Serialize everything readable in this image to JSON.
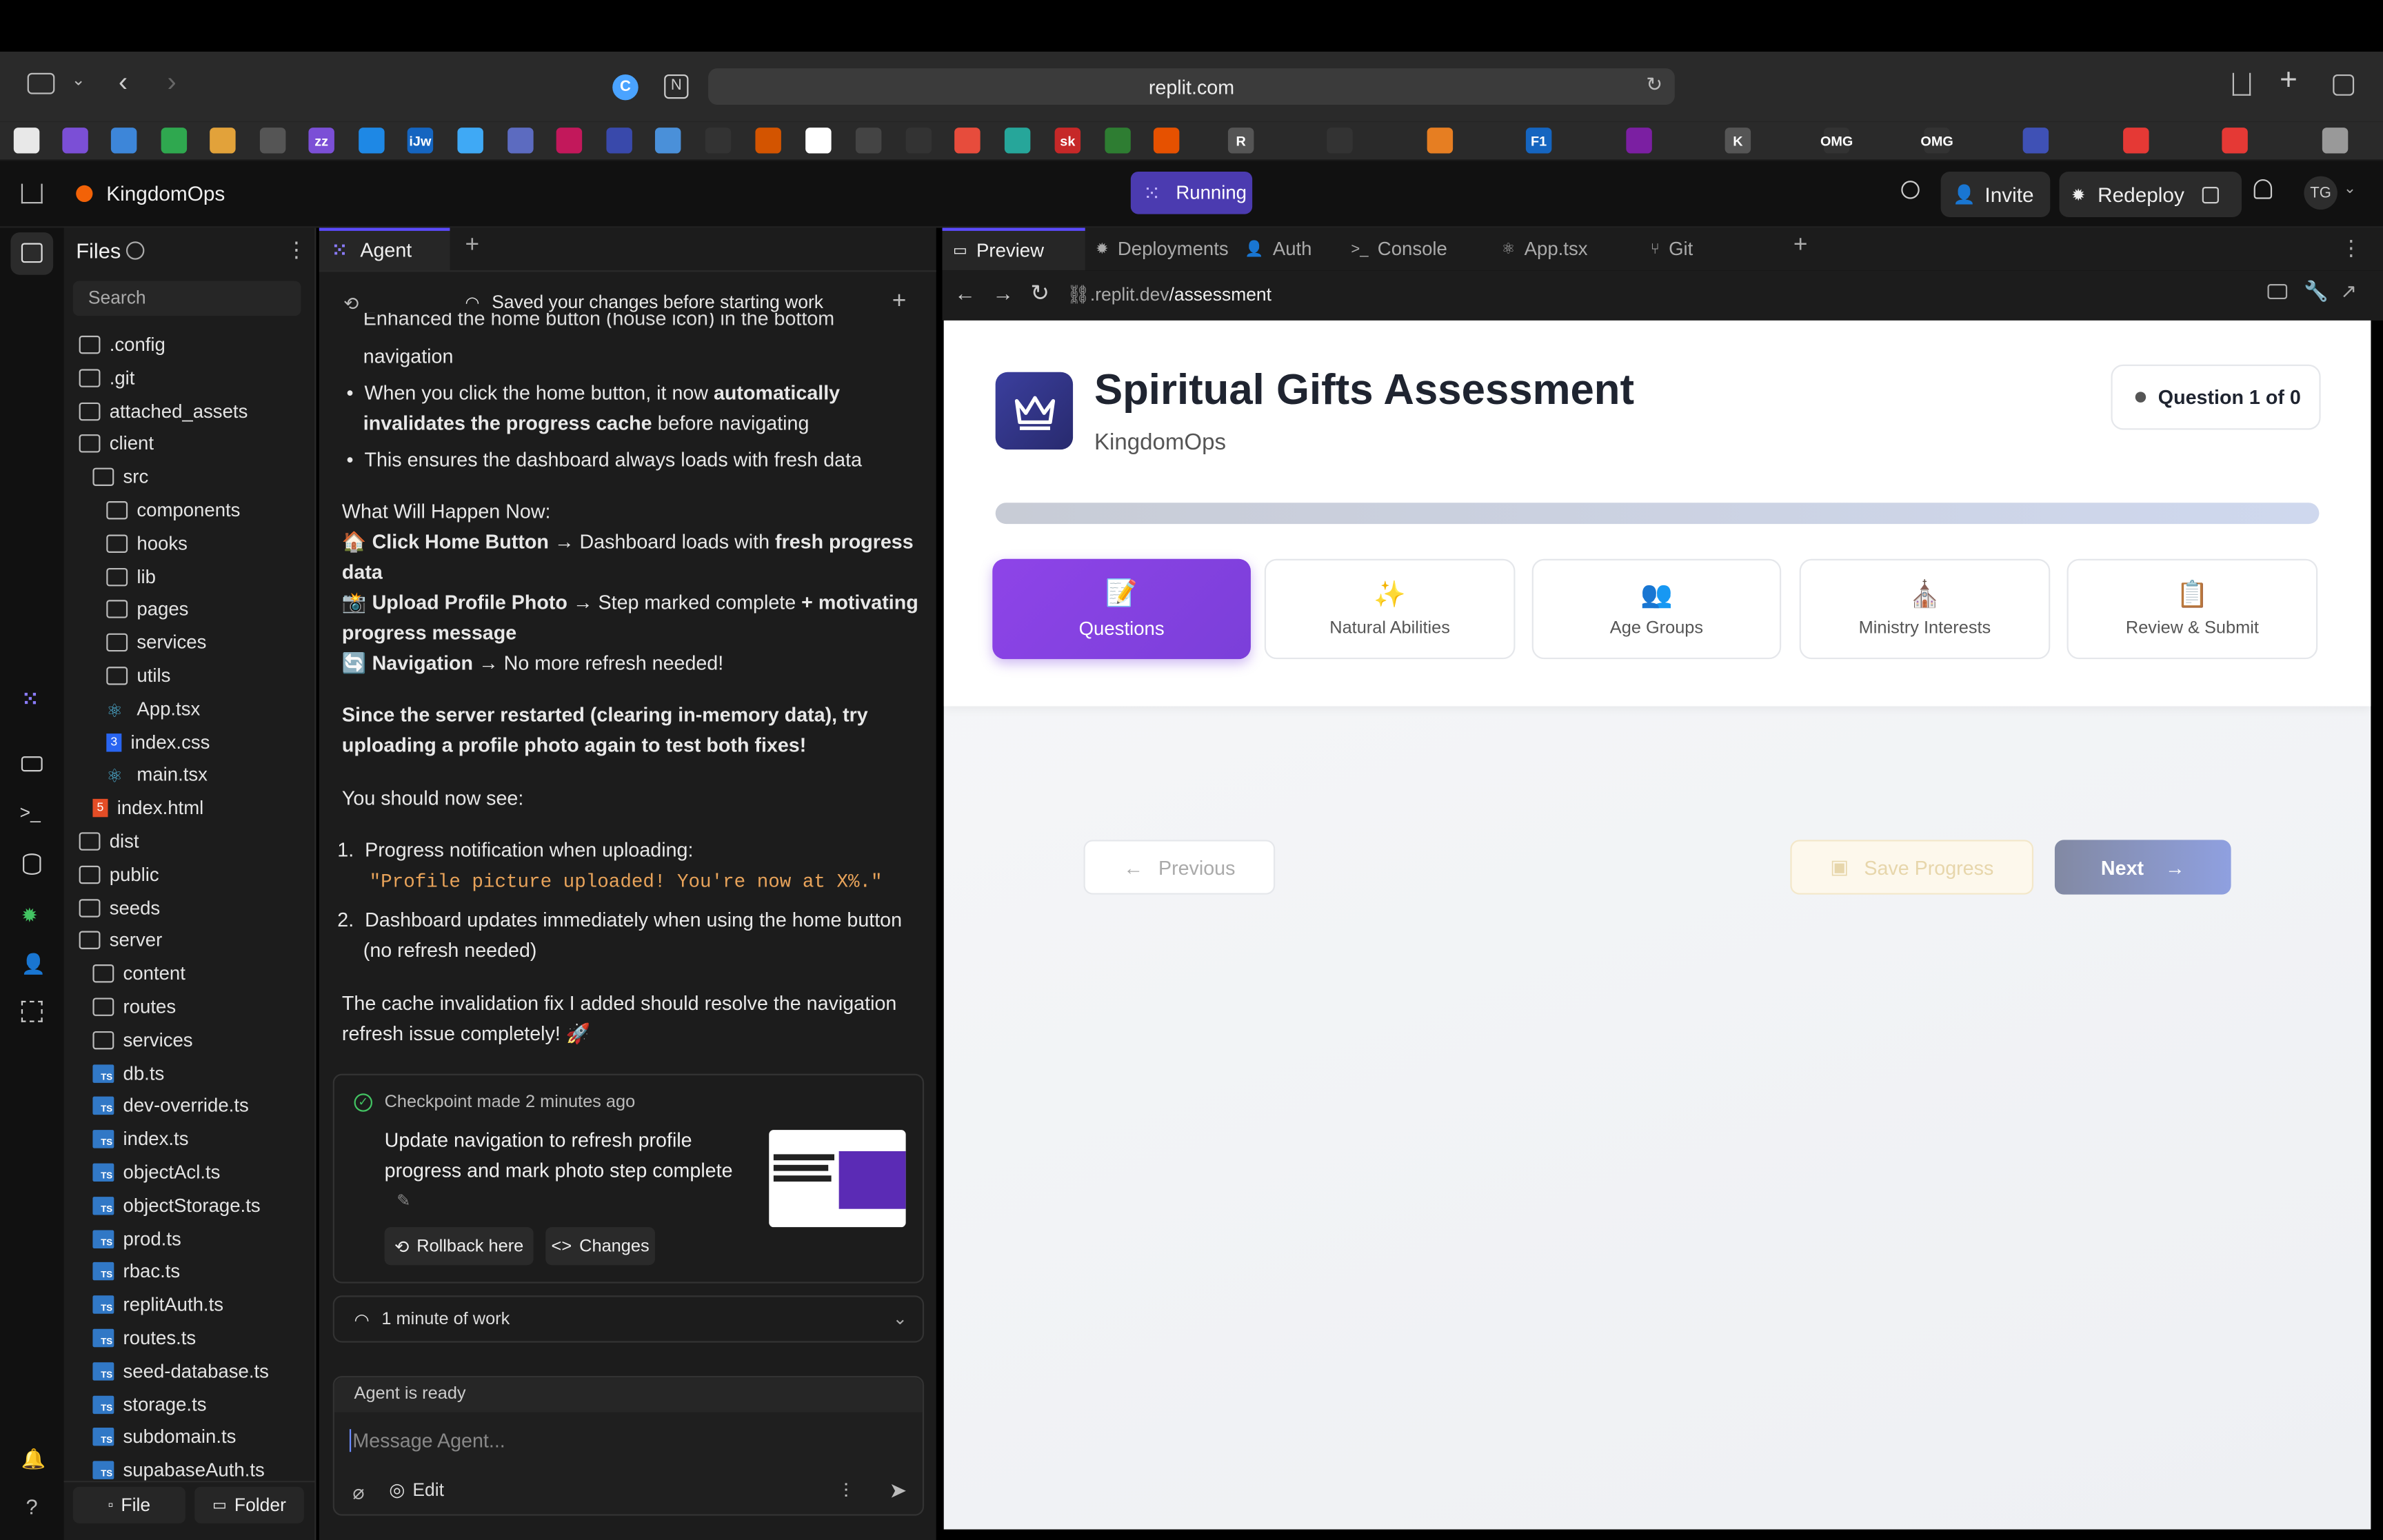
{
  "browser": {
    "url": "replit.com",
    "bookmarks": [
      "",
      "",
      "",
      "",
      "",
      "",
      "zz",
      "",
      "iJw",
      "",
      "",
      "",
      "",
      "",
      "",
      "",
      "",
      "",
      "",
      "",
      "",
      "sk",
      "",
      "",
      "R",
      "",
      "",
      "F1",
      "",
      "K",
      "OMG",
      "OMG",
      "",
      "",
      "",
      ""
    ]
  },
  "header": {
    "app_name": "KingdomOps",
    "status": "Running",
    "invite": "Invite",
    "redeploy": "Redeploy",
    "avatar": "TG"
  },
  "files": {
    "title": "Files",
    "search_placeholder": "Search",
    "items": [
      {
        "name": ".config",
        "type": "folder",
        "indent": 0
      },
      {
        "name": ".git",
        "type": "folder",
        "indent": 0
      },
      {
        "name": "attached_assets",
        "type": "folder",
        "indent": 0
      },
      {
        "name": "client",
        "type": "folder",
        "indent": 0
      },
      {
        "name": "src",
        "type": "folder",
        "indent": 1
      },
      {
        "name": "components",
        "type": "folder",
        "indent": 2
      },
      {
        "name": "hooks",
        "type": "folder",
        "indent": 2
      },
      {
        "name": "lib",
        "type": "folder",
        "indent": 2
      },
      {
        "name": "pages",
        "type": "folder",
        "indent": 2
      },
      {
        "name": "services",
        "type": "folder",
        "indent": 2
      },
      {
        "name": "utils",
        "type": "folder",
        "indent": 2
      },
      {
        "name": "App.tsx",
        "type": "react",
        "indent": 2
      },
      {
        "name": "index.css",
        "type": "css",
        "indent": 2
      },
      {
        "name": "main.tsx",
        "type": "react",
        "indent": 2
      },
      {
        "name": "index.html",
        "type": "html",
        "indent": 1
      },
      {
        "name": "dist",
        "type": "folder",
        "indent": 0
      },
      {
        "name": "public",
        "type": "folder",
        "indent": 0
      },
      {
        "name": "seeds",
        "type": "folder",
        "indent": 0
      },
      {
        "name": "server",
        "type": "folder",
        "indent": 0
      },
      {
        "name": "content",
        "type": "folder",
        "indent": 1
      },
      {
        "name": "routes",
        "type": "folder",
        "indent": 1
      },
      {
        "name": "services",
        "type": "folder",
        "indent": 1
      },
      {
        "name": "db.ts",
        "type": "ts",
        "indent": 1
      },
      {
        "name": "dev-override.ts",
        "type": "ts",
        "indent": 1
      },
      {
        "name": "index.ts",
        "type": "ts",
        "indent": 1
      },
      {
        "name": "objectAcl.ts",
        "type": "ts",
        "indent": 1
      },
      {
        "name": "objectStorage.ts",
        "type": "ts",
        "indent": 1
      },
      {
        "name": "prod.ts",
        "type": "ts",
        "indent": 1
      },
      {
        "name": "rbac.ts",
        "type": "ts",
        "indent": 1
      },
      {
        "name": "replitAuth.ts",
        "type": "ts",
        "indent": 1
      },
      {
        "name": "routes.ts",
        "type": "ts",
        "indent": 1
      },
      {
        "name": "seed-database.ts",
        "type": "ts",
        "indent": 1
      },
      {
        "name": "storage.ts",
        "type": "ts",
        "indent": 1
      },
      {
        "name": "subdomain.ts",
        "type": "ts",
        "indent": 1
      },
      {
        "name": "supabaseAuth.ts",
        "type": "ts",
        "indent": 1
      }
    ],
    "new_file": "File",
    "new_folder": "Folder"
  },
  "agent": {
    "tab": "Agent",
    "saved_notice": "Saved your changes before starting work",
    "cut_line": "Enhanced the home button (house icon) in the bottom",
    "cut_line2": "navigation",
    "b2_pre": "When you click the home button, it now ",
    "b2_bold1": "automatically",
    "b2_bold2": "invalidates the progress cache",
    "b2_post": " before navigating",
    "b3": "This ensures the dashboard always loads with fresh data",
    "happen_title": "What Will Happen Now:",
    "h1_emoji": "🏠",
    "h1_bold": "Click Home Button",
    "h1_mid": " → Dashboard loads with ",
    "h1_bold2": "fresh progress",
    "h1_bold3": "data",
    "h2_emoji": "📸",
    "h2_bold": "Upload Profile Photo",
    "h2_mid": " → Step marked complete ",
    "h2_bold2": "+ motivating",
    "h2_bold3": "progress message",
    "h3_emoji": "🔄",
    "h3_bold": "Navigation",
    "h3_post": " → No more refresh needed!",
    "restart_1": "Since the server restarted (clearing in-memory data), try",
    "restart_2": "uploading a profile photo again to test both fixes!",
    "see": "You should now see:",
    "l1": "Progress notification when uploading:",
    "l1_code": "\"Profile picture uploaded! You're now at X%.\"",
    "l2a": "Dashboard updates immediately when using the home button",
    "l2b": "(no refresh needed)",
    "final1": "The cache invalidation fix I added should resolve the navigation",
    "final2": "refresh issue completely! 🚀",
    "checkpoint_label": "Checkpoint made",
    "checkpoint_time": "2 minutes ago",
    "checkpoint_msg1": "Update navigation to refresh profile",
    "checkpoint_msg2": "progress and mark photo step complete",
    "rollback": "Rollback here",
    "changes": "Changes",
    "work": "1 minute of work",
    "ready": "Agent is ready",
    "input_placeholder": "Message Agent...",
    "edit": "Edit"
  },
  "preview": {
    "tabs": [
      "Preview",
      "Deployments",
      "Auth",
      "Console",
      "App.tsx",
      "Git"
    ],
    "url_prefix": ".replit.dev",
    "url_path": "/assessment",
    "title": "Spiritual Gifts Assessment",
    "subtitle": "KingdomOps",
    "question_badge": "Question 1 of 0",
    "progress": 1.0,
    "steps": [
      {
        "emoji": "📝",
        "label": "Questions",
        "active": true
      },
      {
        "emoji": "✨",
        "label": "Natural Abilities",
        "active": false
      },
      {
        "emoji": "👥",
        "label": "Age Groups",
        "active": false
      },
      {
        "emoji": "⛪",
        "label": "Ministry Interests",
        "active": false
      },
      {
        "emoji": "📋",
        "label": "Review & Submit",
        "active": false
      }
    ],
    "previous": "Previous",
    "save": "Save Progress",
    "next": "Next"
  }
}
